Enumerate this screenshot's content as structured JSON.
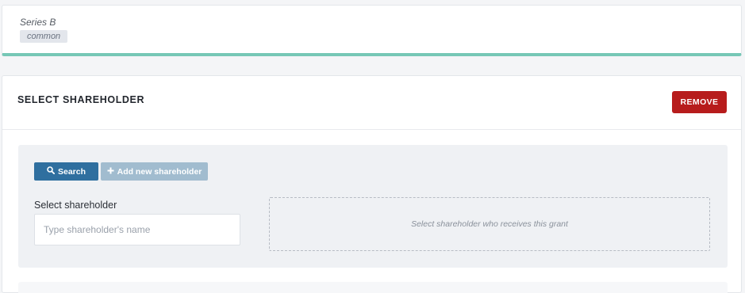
{
  "series": {
    "name": "Series B",
    "share_class": "common"
  },
  "select_shareholder": {
    "title": "SELECT SHAREHOLDER",
    "remove_label": "REMOVE",
    "search_label": "Search",
    "add_new_label": "Add new shareholder",
    "field_label": "Select shareholder",
    "field_placeholder": "Type shareholder's name",
    "recipient_hint": "Select shareholder who receives this grant"
  },
  "colors": {
    "accent_teal": "#76c7b6",
    "remove_red": "#b71c1c",
    "search_blue": "#2f6f9f",
    "add_new_blue_light": "#a1bccf"
  },
  "icons": {
    "search": "search-icon",
    "add": "plus-icon"
  }
}
